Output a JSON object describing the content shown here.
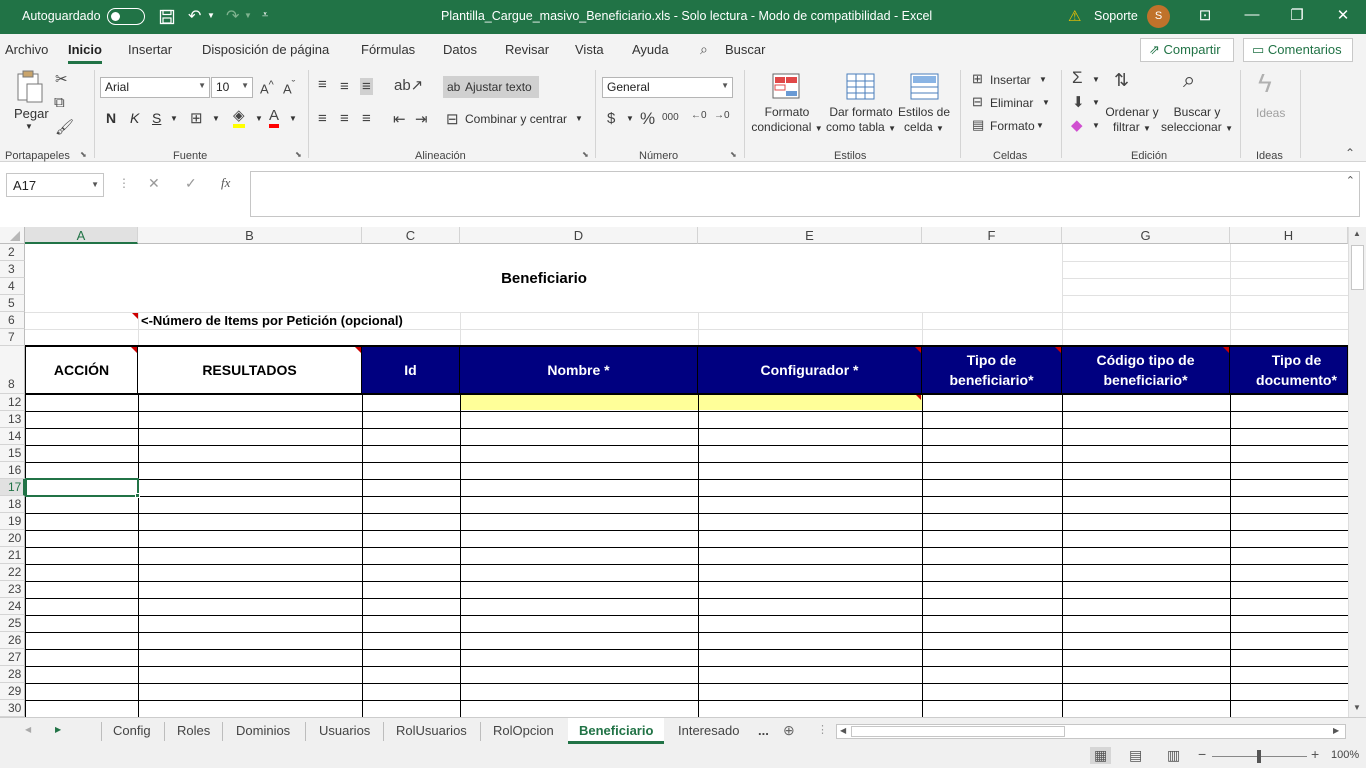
{
  "titlebar": {
    "autosave_label": "Autoguardado",
    "doc_title": "Plantilla_Cargue_masivo_Beneficiario.xls  -  Solo lectura  -  Modo de compatibilidad  -  Excel",
    "user_name": "Soporte",
    "user_initial": "S"
  },
  "menu": {
    "items": [
      "Archivo",
      "Inicio",
      "Insertar",
      "Disposición de página",
      "Fórmulas",
      "Datos",
      "Revisar",
      "Vista",
      "Ayuda",
      "Buscar"
    ],
    "share_label": "Compartir",
    "comments_label": "Comentarios"
  },
  "ribbon": {
    "paste_label": "Pegar",
    "font_name": "Arial",
    "font_size": "10",
    "bold": "N",
    "italic": "K",
    "underline": "S",
    "wrap_text": "Ajustar texto",
    "merge_center": "Combinar y centrar",
    "number_format": "General",
    "cond_format_1": "Formato",
    "cond_format_2": "condicional",
    "table_format_1": "Dar formato",
    "table_format_2": "como tabla",
    "cell_styles_1": "Estilos de",
    "cell_styles_2": "celda",
    "insert": "Insertar",
    "delete": "Eliminar",
    "format": "Formato",
    "sort_1": "Ordenar y",
    "sort_2": "filtrar",
    "find_1": "Buscar y",
    "find_2": "seleccionar",
    "ideas": "Ideas",
    "groups": [
      "Portapapeles",
      "Fuente",
      "Alineación",
      "Número",
      "Estilos",
      "Celdas",
      "Edición",
      "Ideas"
    ]
  },
  "formula_bar": {
    "name_box": "A17",
    "fx": "fx",
    "content": ""
  },
  "sheet": {
    "columns": [
      "A",
      "B",
      "C",
      "D",
      "E",
      "F",
      "G",
      "H"
    ],
    "rows": [
      "2",
      "3",
      "4",
      "5",
      "6",
      "7",
      "8",
      "12",
      "13",
      "14",
      "15",
      "16",
      "17",
      "18",
      "19",
      "20",
      "21",
      "22",
      "23",
      "24",
      "25",
      "26",
      "27",
      "28",
      "29",
      "30"
    ],
    "title": "Beneficiario",
    "row6_note": "<-Número de Items por Petición (opcional)",
    "headers": [
      "ACCIÓN",
      "RESULTADOS",
      "Id",
      "Nombre *",
      "Configurador *",
      "Tipo de beneficiario*",
      "Código tipo de beneficiario*",
      "Tipo de documento*"
    ]
  },
  "tabs": {
    "items": [
      "Config",
      "Roles",
      "Dominios",
      "Usuarios",
      "RolUsuarios",
      "RolOpcion",
      "Beneficiario",
      "Interesado"
    ],
    "active": "Beneficiario",
    "more": "..."
  },
  "status": {
    "zoom": "100%"
  },
  "colors": {
    "excel_green": "#217346",
    "header_navy": "#000080",
    "highlight_yellow": "#ffff99"
  }
}
